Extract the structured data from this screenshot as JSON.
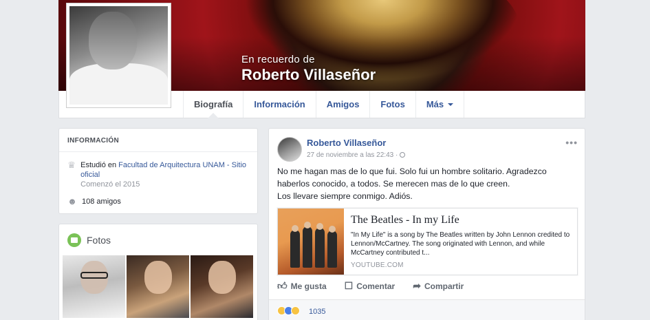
{
  "cover": {
    "memorial_label": "En recuerdo de",
    "name": "Roberto Villaseñor"
  },
  "tabs": [
    {
      "label": "Biografía",
      "active": true
    },
    {
      "label": "Información"
    },
    {
      "label": "Amigos"
    },
    {
      "label": "Fotos"
    },
    {
      "label": "Más"
    }
  ],
  "info": {
    "header": "INFORMACIÓN",
    "studied_prefix": "Estudió en ",
    "school": "Facultad de Arquitectura UNAM - Sitio oficial",
    "started": "Comenzó el 2015",
    "friends": "108 amigos"
  },
  "photos": {
    "title": "Fotos"
  },
  "post": {
    "author": "Roberto Villaseñor",
    "timestamp": "27 de noviembre a las 22:43 ·",
    "more": "•••",
    "text_line1": "No me hagan mas de lo que fui. Solo fui un hombre solitario. Agradezco haberlos conocido, a todos. Se merecen mas de lo que creen.",
    "text_line2": "Los llevare siempre conmigo. Adiós.",
    "link": {
      "title": "The Beatles - In my Life",
      "description": "\"In My Life\" is a song by The Beatles written by John Lennon credited to Lennon/McCartney. The song originated with Lennon, and while McCartney contributed t...",
      "domain": "YOUTUBE.COM"
    },
    "actions": {
      "like": "Me gusta",
      "comment": "Comentar",
      "share": "Compartir"
    },
    "reactions_count": "1035"
  },
  "colors": {
    "link_blue": "#365899",
    "background": "#e9ebee",
    "like_blue": "#4a7fe8",
    "emoji_yellow": "#f7c343"
  }
}
